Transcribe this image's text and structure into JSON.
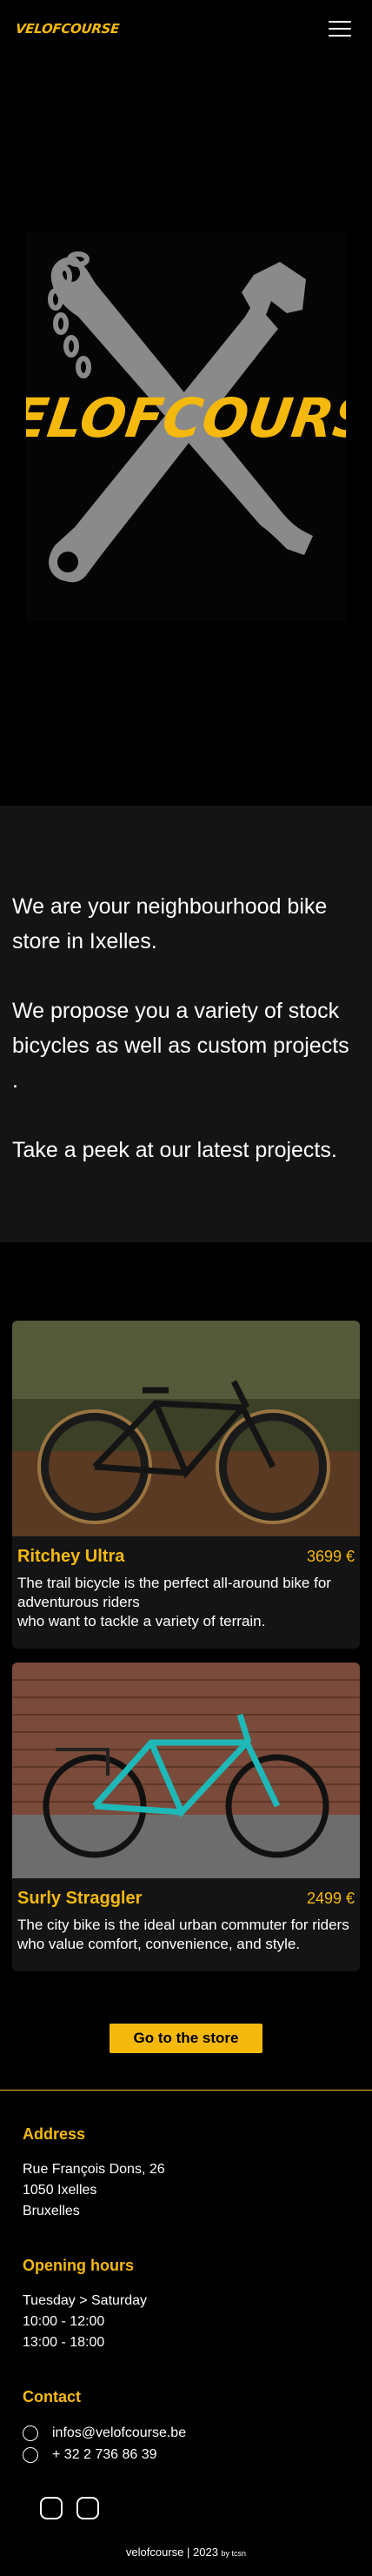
{
  "header": {
    "logo_text": "VELOFCOURSE",
    "menu_icon": "hamburger-icon"
  },
  "hero": {
    "logo_text": "VELOFCOURSE"
  },
  "intro": {
    "p1": "We are your neighbourhood bike store in Ixelles.",
    "p2": "We propose you a variety of stock bicycles as well as custom projects .",
    "p3": "Take a peek at our latest projects."
  },
  "projects": [
    {
      "title": "Ritchey Ultra",
      "price": "3699 €",
      "desc_1": "The trail bicycle is the perfect all-around bike for adventurous riders",
      "desc_2": "who want to tackle a variety of terrain."
    },
    {
      "title": "Surly Straggler",
      "price": "2499 €",
      "desc_1": "The city bike is the ideal urban commuter for riders who value comfort, convenience, and style.",
      "desc_2": ""
    }
  ],
  "store_button": "Go to the store",
  "footer": {
    "address_heading": "Address",
    "address_1": "Rue François Dons, 26",
    "address_2": "1050 Ixelles",
    "address_3": "Bruxelles",
    "hours_heading": "Opening hours",
    "hours_1": "Tuesday > Saturday",
    "hours_2": "10:00 - 12:00",
    "hours_3": "13:00 - 18:00",
    "contact_heading": "Contact",
    "email": "infos@velofcourse.be",
    "phone": "+ 32 2 736 86 39",
    "copyright": "velofcourse | 2023",
    "by": "by tcsn"
  },
  "colors": {
    "accent": "#f5b90d",
    "bg": "#000000",
    "panel": "#141414"
  }
}
